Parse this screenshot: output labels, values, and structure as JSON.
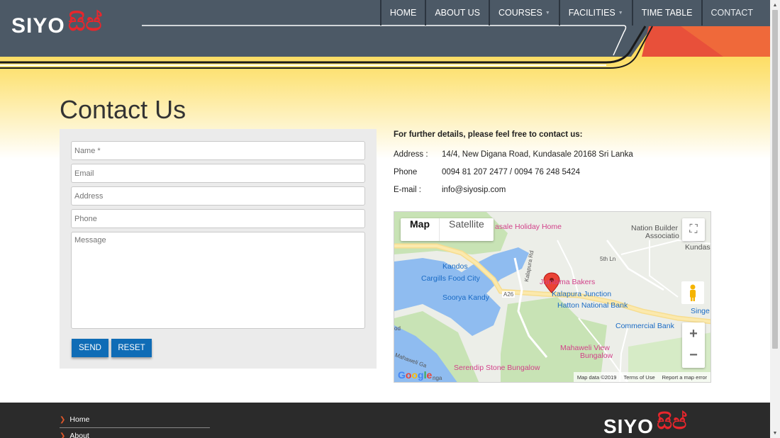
{
  "brand": {
    "logo_text": "SIYO",
    "logo_sinhala": "සිප්",
    "colors": {
      "header": "#4c5966",
      "accent": "#e8262c",
      "button": "#0f6cb6",
      "yellow": "#fdd236",
      "footer": "#2b2b2b"
    }
  },
  "nav": {
    "items": [
      {
        "label": "HOME",
        "dropdown": false
      },
      {
        "label": "ABOUT US",
        "dropdown": false
      },
      {
        "label": "COURSES",
        "dropdown": true
      },
      {
        "label": "FACILITIES",
        "dropdown": true
      },
      {
        "label": "TIME TABLE",
        "dropdown": false
      },
      {
        "label": "CONTACT",
        "dropdown": false
      }
    ]
  },
  "page": {
    "title": "Contact Us"
  },
  "form": {
    "name_placeholder": "Name *",
    "email_placeholder": "Email",
    "address_placeholder": "Address",
    "phone_placeholder": "Phone",
    "message_placeholder": "Message",
    "send_label": "SEND",
    "reset_label": "RESET"
  },
  "contact": {
    "heading": "For further details, please feel free to contact us:",
    "address_label": "Address :",
    "address_value": "14/4, New Digana Road, Kundasale 20168 Sri Lanka",
    "phone_label": "Phone",
    "phone_value": "0094 81 207 2477 / 0094 76 248 5424",
    "email_label": "E-mail :",
    "email_value": "info@siyosip.com"
  },
  "map": {
    "type_map": "Map",
    "type_satellite": "Satellite",
    "labels": {
      "holiday": "asale Holiday Home",
      "nation": "Nation Builder",
      "association": "Associatio",
      "kundas": "Kundas",
      "fifth_ln": "5th Ln",
      "kandos": "Kandos",
      "cargills": "Cargills Food City",
      "jumbo": "Jumbima Bakers",
      "kalapura_rd": "Kalapura Rd",
      "kalapura_jn": "Kalapura Junction",
      "a26": "A26",
      "soorya": "Soorya Kandy",
      "hatton": "Hatton National Bank",
      "singe": "Singe",
      "commercial": "Commercial Bank",
      "mahaweli": "Mahaweli View",
      "bungalow": "Bungalow",
      "serendip": "Serendip Stone Bungalow",
      "google": "Google",
      "mahaweli_ganga": "Mahaweli Ga",
      "nga": "nga",
      "od": "od"
    },
    "footer": {
      "data": "Map data ©2019",
      "terms": "Terms of Use",
      "report": "Report a map error"
    }
  },
  "footer": {
    "links": [
      "Home",
      "About"
    ]
  }
}
